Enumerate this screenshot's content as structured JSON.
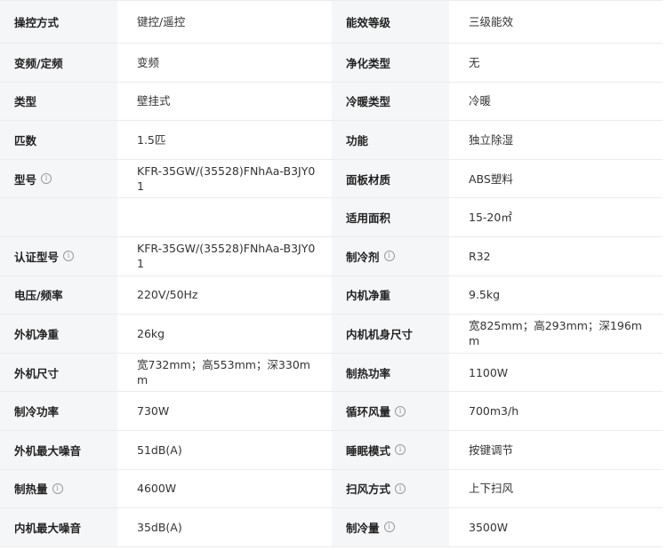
{
  "rows": [
    {
      "l1": "操控方式",
      "v1": "键控/遥控",
      "l2": "能效等级",
      "v2": "三级能效"
    },
    {
      "l1": "变频/定频",
      "v1": "变频",
      "l2": "净化类型",
      "v2": "无"
    },
    {
      "l1": "类型",
      "v1": "壁挂式",
      "l2": "冷暖类型",
      "v2": "冷暖"
    },
    {
      "l1": "匹数",
      "v1": "1.5匹",
      "l2": "功能",
      "v2": "独立除湿"
    },
    {
      "l1": "型号",
      "v1": "KFR-35GW/(35528)FNhAa-B3JY01",
      "l2": "面板材质",
      "v2": "ABS塑料"
    },
    {
      "l1": "",
      "v1": "",
      "l2": "适用面积",
      "v2": "15-20㎡"
    },
    {
      "l1": "认证型号",
      "v1": "KFR-35GW/(35528)FNhAa-B3JY01",
      "l2": "制冷剂",
      "v2": "R32"
    },
    {
      "l1": "电压/频率",
      "v1": "220V/50Hz",
      "l2": "内机净重",
      "v2": "9.5kg"
    },
    {
      "l1": "外机净重",
      "v1": "26kg",
      "l2": "内机机身尺寸",
      "v2": "宽825mm；高293mm；深196mm"
    },
    {
      "l1": "外机尺寸",
      "v1": "宽732mm；高553mm；深330mm",
      "l2": "制热功率",
      "v2": "1100W"
    },
    {
      "l1": "制冷功率",
      "v1": "730W",
      "l2": "循环风量",
      "v2": "700m3/h"
    },
    {
      "l1": "外机最大噪音",
      "v1": "51dB(A)",
      "l2": "睡眠模式",
      "v2": "按键调节"
    },
    {
      "l1": "制热量",
      "v1": "4600W",
      "l2": "扫风方式",
      "v2": "上下扫风"
    },
    {
      "l1": "内机最大噪音",
      "v1": "35dB(A)",
      "l2": "制冷量",
      "v2": "3500W"
    }
  ],
  "icons": {
    "info": "info-circle-icon",
    "glyph": "i"
  }
}
